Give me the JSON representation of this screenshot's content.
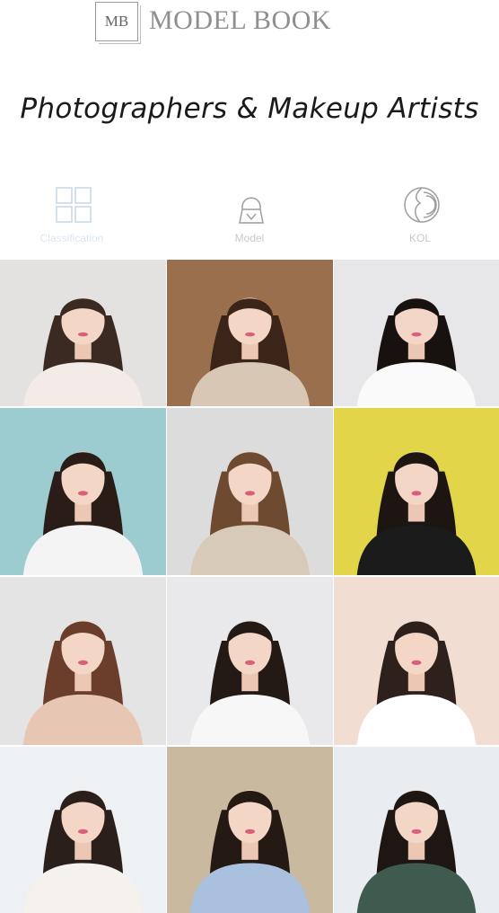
{
  "brand": {
    "mark": "MB",
    "name": "MODEL BOOK"
  },
  "headline": "Photographers & Makeup Artists",
  "nav": [
    {
      "label": "Classification",
      "icon": "grid-icon",
      "active": true
    },
    {
      "label": "Model",
      "icon": "model-icon",
      "active": false
    },
    {
      "label": "KOL",
      "icon": "kol-icon",
      "active": false
    }
  ],
  "photos": [
    {
      "bg": "#e4e2e0",
      "hair": "#3a2a22",
      "top": "#f2ebe7"
    },
    {
      "bg": "#9a6f4e",
      "hair": "#3b2518",
      "top": "#d9c7b6"
    },
    {
      "bg": "#e7e7e9",
      "hair": "#17120f",
      "top": "#fafafa"
    },
    {
      "bg": "#9ccbd0",
      "hair": "#2a1c16",
      "top": "#f4f4f4"
    },
    {
      "bg": "#dcdcdc",
      "hair": "#6e4a30",
      "top": "#d8cab8"
    },
    {
      "bg": "#e2d54a",
      "hair": "#1d1512",
      "top": "#1b1b1b"
    },
    {
      "bg": "#e4e4e4",
      "hair": "#6a3e2a",
      "top": "#e8c6b4"
    },
    {
      "bg": "#e9e9ec",
      "hair": "#241a15",
      "top": "#f7f7f7"
    },
    {
      "bg": "#f1ddd2",
      "hair": "#2e201a",
      "top": "#ffffff"
    },
    {
      "bg": "#eef1f4",
      "hair": "#2a1f1a",
      "top": "#f5f1ec"
    },
    {
      "bg": "#c9b99e",
      "hair": "#241913",
      "top": "#a9c0de"
    },
    {
      "bg": "#e9edf1",
      "hair": "#1e1612",
      "top": "#3f5b4f"
    }
  ]
}
